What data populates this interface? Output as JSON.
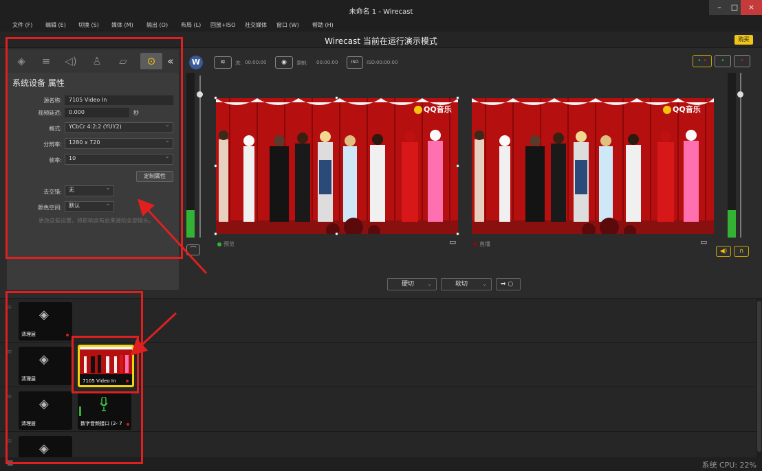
{
  "window": {
    "title": "未命名 1 - Wirecast",
    "min": "–",
    "max": "□",
    "close": "×"
  },
  "menu": [
    "文件 (F)",
    "编辑 (E)",
    "切换 (S)",
    "媒体 (M)",
    "输出 (O)",
    "布局 (L)",
    "回放+ISO",
    "社交媒体",
    "窗口 (W)",
    "帮助 (H)"
  ],
  "mode_banner": "Wirecast 当前在运行演示模式",
  "buy_label": "购买",
  "properties": {
    "title": "系统设备 属性",
    "tab_icons": [
      "layers-icon",
      "sliders-icon",
      "speaker-icon",
      "person-icon",
      "crop-icon",
      "more-icon"
    ],
    "collapse": "«",
    "fields": {
      "source_name_label": "源名称:",
      "source_name_value": "7105 Video In",
      "video_delay_label": "视频延迟:",
      "video_delay_value": "0.000",
      "video_delay_unit": "秒",
      "format_label": "格式:",
      "format_value": "YCbCr 4:2:2 (YUY2)",
      "resolution_label": "分辨率:",
      "resolution_value": "1280 x 720",
      "framerate_label": "帧率:",
      "framerate_value": "10",
      "custom_button": "定制属性",
      "deinterlace_label": "去交错:",
      "deinterlace_value": "无",
      "colorspace_label": "颜色空间:",
      "colorspace_value": "默认",
      "hint": "更改这些设置，将影响含有此来源的全部镜头。"
    }
  },
  "controls": {
    "stream_label": "流:",
    "stream_time": "00:00:00",
    "record_label": "录制:",
    "record_time": "00:00:00",
    "iso_label": "ISO:",
    "iso_time": "00:00:00",
    "iso_badge": "ISO"
  },
  "preview": {
    "label": "预览",
    "watermark": "QQ音乐"
  },
  "live": {
    "label": "直播",
    "watermark": "QQ音乐"
  },
  "transitions": {
    "cut": "硬切",
    "smooth": "软切",
    "go": "➡ ○"
  },
  "layers": [
    {
      "shots": [
        {
          "label": "清理层",
          "type": "clear"
        }
      ]
    },
    {
      "shots": [
        {
          "label": "清理层",
          "type": "clear"
        },
        {
          "label": "7105 Video In",
          "type": "video",
          "selected": true
        }
      ]
    },
    {
      "shots": [
        {
          "label": "清理层",
          "type": "clear"
        },
        {
          "label": "数字音频接口 (2- 7",
          "type": "audio"
        }
      ]
    },
    {
      "shots": [
        {
          "label": "清理层",
          "type": "clear"
        }
      ]
    }
  ],
  "cpu": "系统 CPU:   22%",
  "colors": {
    "accent": "#f2c40e",
    "annotation": "#e02020",
    "meter": "#34b233",
    "stage_red": "#c11111"
  }
}
